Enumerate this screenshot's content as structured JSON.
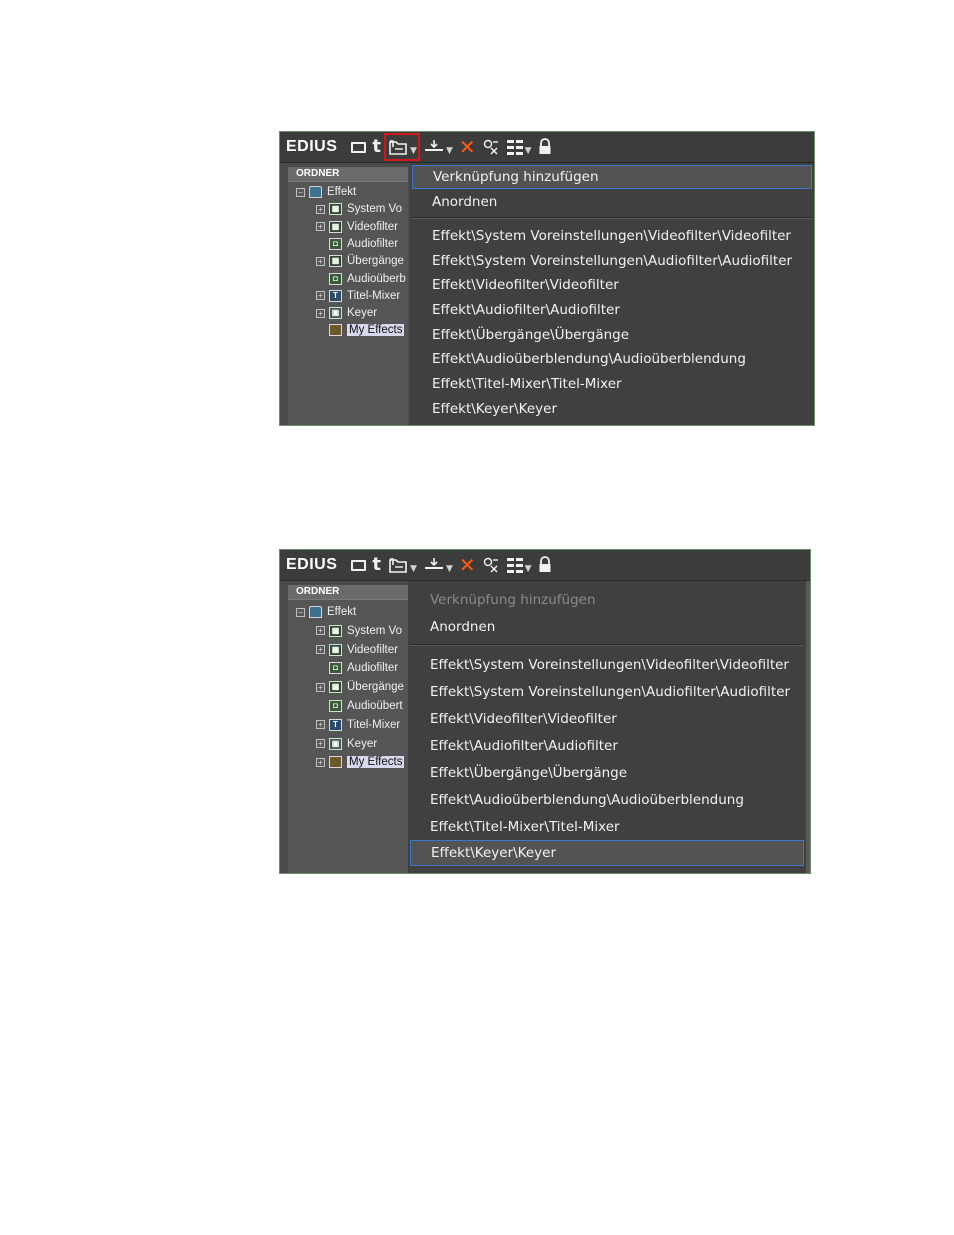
{
  "app": {
    "title": "EDIUS"
  },
  "panel": {
    "header": "ORDNER"
  },
  "tree1": [
    {
      "label": "Effekt",
      "exp": "minus"
    },
    {
      "label": "System Vo",
      "exp": "plus"
    },
    {
      "label": "Videofilter",
      "exp": "plus"
    },
    {
      "label": "Audiofilter",
      "exp": "none"
    },
    {
      "label": "Übergänge",
      "exp": "plus"
    },
    {
      "label": "Audioüberb",
      "exp": "none"
    },
    {
      "label": "Titel-Mixer",
      "exp": "plus"
    },
    {
      "label": "Keyer",
      "exp": "plus"
    },
    {
      "label": "My Effects",
      "exp": "none",
      "selected": true
    }
  ],
  "tree2": [
    {
      "label": "Effekt",
      "exp": "minus"
    },
    {
      "label": "System Vo",
      "exp": "plus"
    },
    {
      "label": "Videofilter",
      "exp": "plus"
    },
    {
      "label": "Audiofilter",
      "exp": "none"
    },
    {
      "label": "Übergänge",
      "exp": "plus"
    },
    {
      "label": "Audioübert",
      "exp": "none"
    },
    {
      "label": "Titel-Mixer",
      "exp": "plus"
    },
    {
      "label": "Keyer",
      "exp": "plus"
    },
    {
      "label": "My Effects",
      "exp": "plus",
      "selected": true
    }
  ],
  "menu": {
    "add_shortcut": "Verknüpfung hinzufügen",
    "arrange": "Anordnen",
    "paths": [
      "Effekt\\System Voreinstellungen\\Videofilter\\Videofilter",
      "Effekt\\System Voreinstellungen\\Audiofilter\\Audiofilter",
      "Effekt\\Videofilter\\Videofilter",
      "Effekt\\Audiofilter\\Audiofilter",
      "Effekt\\Übergänge\\Übergänge",
      "Effekt\\Audioüberblendung\\Audioüberblendung",
      "Effekt\\Titel-Mixer\\Titel-Mixer",
      "Effekt\\Keyer\\Keyer"
    ]
  },
  "toolbar_icons": [
    "new-folder-icon",
    "up-folder-icon",
    "add-shortcut-icon",
    "import-icon",
    "delete-icon",
    "properties-icon",
    "view-icon",
    "lock-icon"
  ],
  "colors": {
    "highlight_border": "#3e78c8",
    "selected_tool_outline": "#d11818",
    "delete_icon": "#ff5a10"
  }
}
